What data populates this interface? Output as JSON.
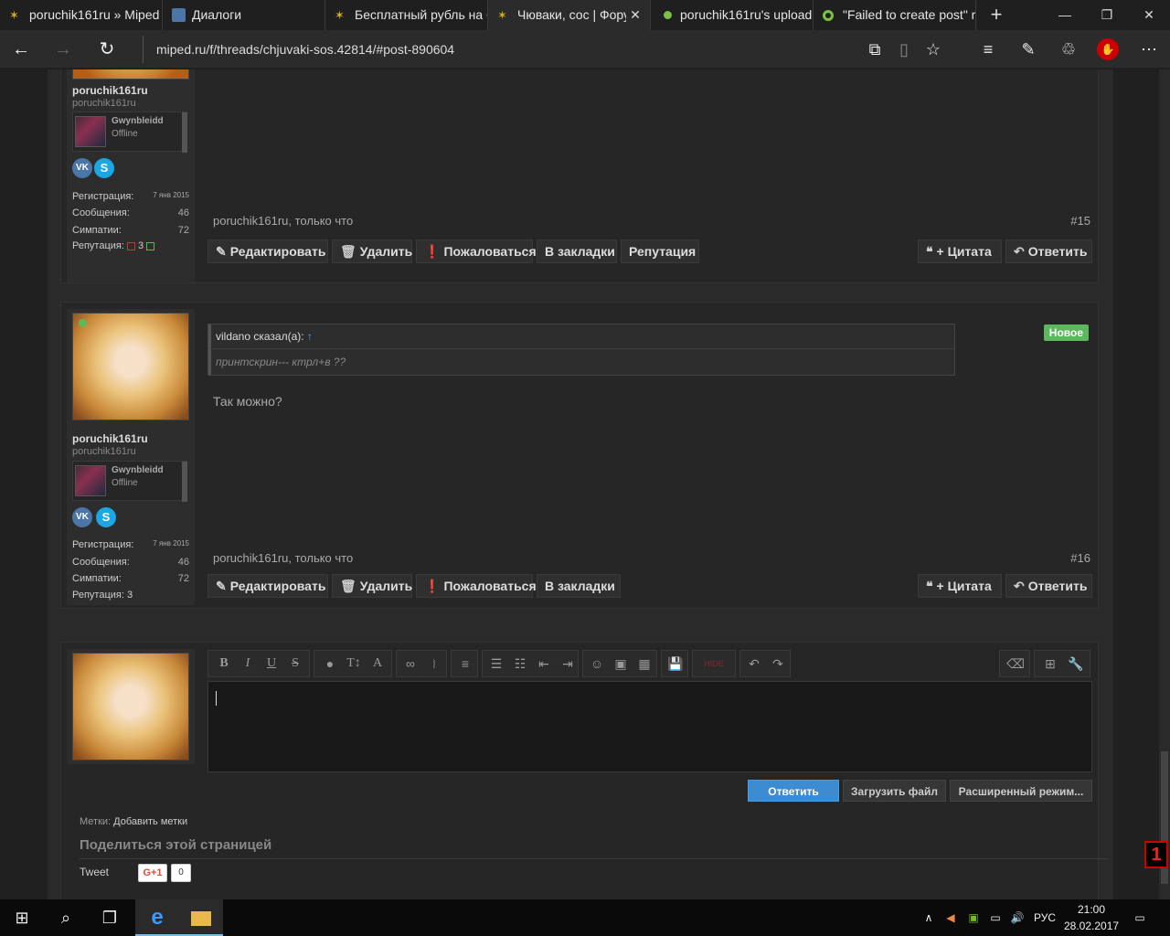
{
  "tabs": [
    {
      "title": "poruchik161ru » Miped",
      "active": false
    },
    {
      "title": "Диалоги",
      "active": false
    },
    {
      "title": "Бесплатный рубль на С",
      "active": false
    },
    {
      "title": "Чюваки, сос | Фору",
      "active": true
    },
    {
      "title": "poruchik161ru's upload",
      "active": false
    },
    {
      "title": "\"Failed to create post\" r",
      "active": false
    }
  ],
  "address": {
    "url": "miped.ru/f/threads/chjuvaki-sos.42814/#post-890604"
  },
  "post15": {
    "username": "poruchik161ru",
    "usertitle": "poruchik161ru",
    "guild_name": "Gwynbleidd",
    "guild_status": "Offline",
    "vk": "VK",
    "stats": {
      "reg_label": "Регистрация:",
      "reg_value": "7 янв 2015",
      "msg_label": "Сообщения:",
      "msg_value": "46",
      "likes_label": "Симпатии:",
      "likes_value": "72",
      "rep_label": "Репутация:",
      "rep_value": "3"
    },
    "meta": "poruchik161ru, только что",
    "number": "#15",
    "buttons": {
      "edit": "Редактировать",
      "delete": "Удалить",
      "report": "Пожаловаться",
      "bookmark": "В закладки",
      "reputation": "Репутация",
      "quote": "+ Цитата",
      "reply": "Ответить"
    }
  },
  "post16": {
    "username": "poruchik161ru",
    "usertitle": "poruchik161ru",
    "guild_name": "Gwynbleidd",
    "guild_status": "Offline",
    "vk": "VK",
    "stats": {
      "reg_label": "Регистрация:",
      "reg_value": "7 янв 2015",
      "msg_label": "Сообщения:",
      "msg_value": "46",
      "likes_label": "Симпатии:",
      "likes_value": "72",
      "rep_label": "Репутация: 3"
    },
    "quote_author": "vildano сказал(а):",
    "quote_text": "принтскрин--- ктрл+в ??",
    "new_badge": "Новое",
    "message": "Так можно?",
    "meta": "poruchik161ru, только что",
    "number": "#16",
    "buttons": {
      "edit": "Редактировать",
      "delete": "Удалить",
      "report": "Пожаловаться",
      "bookmark": "В закладки",
      "quote": "+ Цитата",
      "reply": "Ответить"
    }
  },
  "editor": {
    "toolbar_icons": [
      "bold-icon",
      "italic-icon",
      "underline-icon",
      "strike-icon",
      "color-icon",
      "font-size-icon",
      "font-icon",
      "link-icon",
      "unlink-icon",
      "align-icon",
      "bullet-list-icon",
      "numbered-list-icon",
      "outdent-icon",
      "indent-icon",
      "smiley-icon",
      "image-icon",
      "media-icon",
      "save-icon",
      "hide-icon",
      "undo-icon",
      "redo-icon",
      "eraser-icon",
      "expand-icon",
      "wrench-icon"
    ],
    "hide_label": "HIDE",
    "reply_button": "Ответить",
    "upload_button": "Загрузить файл",
    "advanced_button": "Расширенный режим..."
  },
  "footer": {
    "tags_label": "Метки:",
    "tags_add": "Добавить метки",
    "share_title": "Поделиться этой страницей",
    "tweet": "Tweet",
    "gplus": "G+1",
    "gplus_count": "0"
  },
  "taskbar": {
    "lang": "РУС",
    "time": "21:00",
    "date": "28.02.2017"
  },
  "colors": {
    "accent": "#4a90d9",
    "online": "#5cb85c",
    "new_badge": "#5cb85c"
  }
}
